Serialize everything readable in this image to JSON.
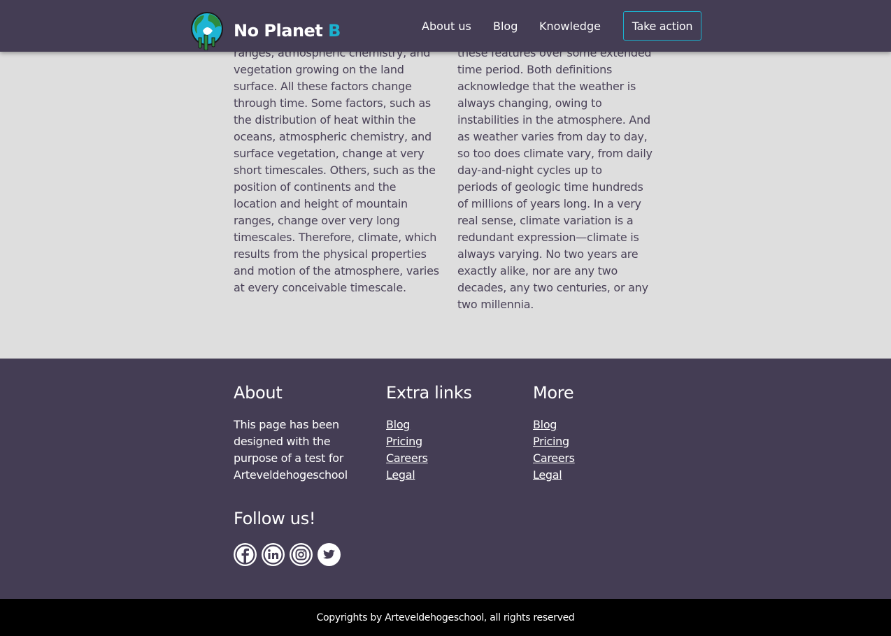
{
  "header": {
    "brand_main": "No Planet ",
    "brand_accent": "B",
    "nav": [
      "About us",
      "Blog",
      "Knowledge"
    ],
    "cta_label": "Take action",
    "accent_color": "#1bb2cf",
    "background_color": "#443d54"
  },
  "article": {
    "left_lines": [
      "ranges, atmospheric chemistry, and",
      "vegetation growing on the land",
      "surface. All these factors change",
      "through time. Some factors, such as",
      "the distribution of heat within the",
      "oceans, atmospheric chemistry, and",
      "surface vegetation, change at very",
      "short timescales. Others, such as the",
      "position of continents and the",
      "location and height of mountain",
      "ranges, change over very long",
      "timescales. Therefore, climate, which",
      "results from the physical properties",
      "and motion of the atmosphere, varies",
      "at every conceivable timescale."
    ],
    "right_lines": [
      "these features over some extended",
      "time period. Both definitions",
      "acknowledge that the weather is",
      "always changing, owing to",
      "instabilities in the atmosphere. And",
      "as weather varies from day to day,",
      "so too does climate vary, from daily",
      "day-and-night cycles up to",
      "periods of geologic time hundreds",
      "of millions of years long. In a very",
      "real sense, climate variation is a",
      "redundant expression—climate is",
      "always varying. No two years are",
      "exactly alike, nor are any two",
      "decades, any two centuries, or any",
      "two millennia."
    ]
  },
  "footer": {
    "about_title": "About",
    "about_lines": [
      "This page has been",
      "designed with the",
      "purpose of a test for",
      "Arteveldehogeschool"
    ],
    "extra_title": "Extra links",
    "extra_links": [
      "Blog",
      "Pricing",
      "Careers",
      "Legal"
    ],
    "more_title": "More",
    "more_links": [
      "Blog",
      "Pricing",
      "Careers",
      "Legal"
    ],
    "follow_title": "Follow us!",
    "socials": [
      "facebook-icon",
      "linkedin-icon",
      "instagram-icon",
      "twitter-icon"
    ]
  },
  "copyright": "Copyrights by Arteveldehogeschool, all rights reserved"
}
